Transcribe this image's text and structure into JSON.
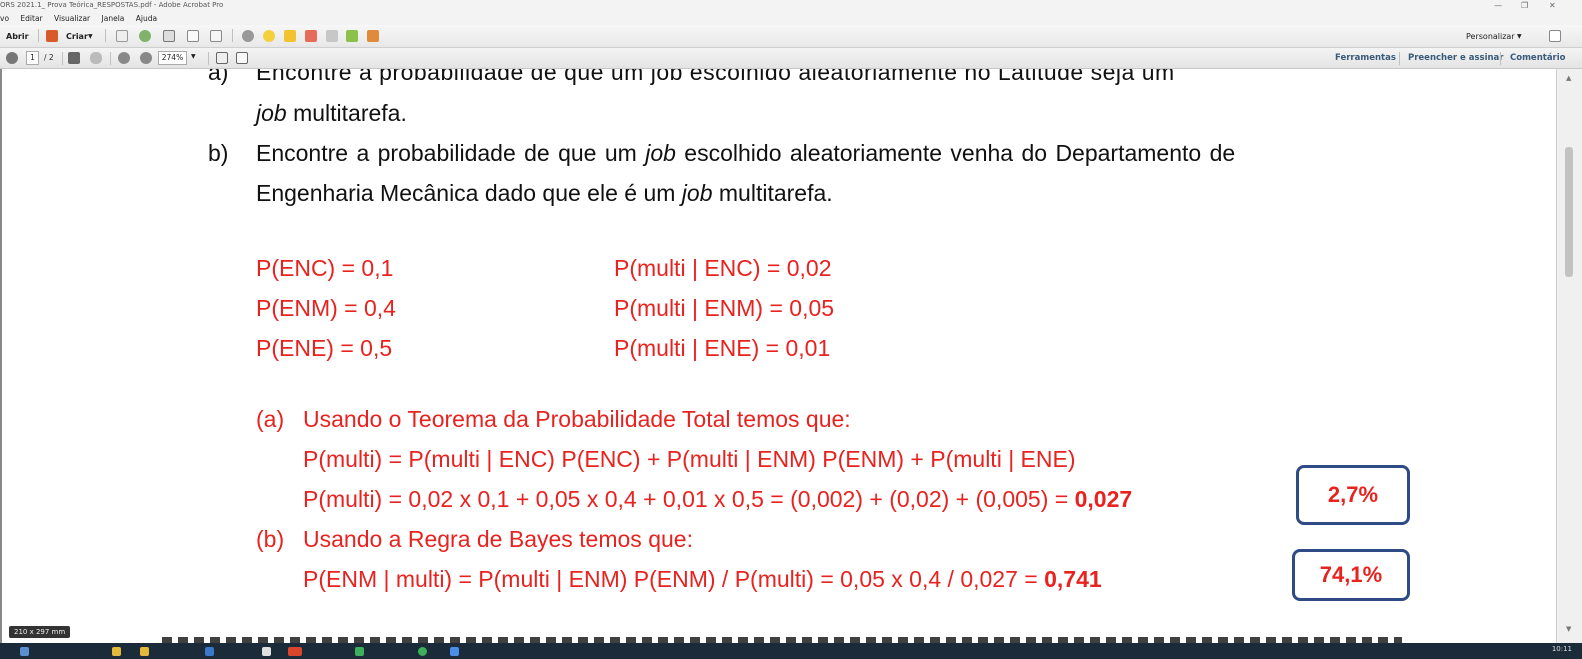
{
  "window": {
    "title": "ORS 2021.1_ Prova Teórica_RESPOSTAS.pdf - Adobe Acrobat Pro"
  },
  "menu": [
    "vo",
    "Editar",
    "Visualizar",
    "Janela",
    "Ajuda"
  ],
  "toolbar": {
    "open_label": "Abrir",
    "create_label": "Criar",
    "customize_label": "Personalizar"
  },
  "nav": {
    "page_current": "1",
    "page_total": "/ 2",
    "zoom": "274%",
    "tools_label": "Ferramentas",
    "fill_sign_label": "Preencher e assinar",
    "comment_label": "Comentário"
  },
  "document": {
    "item_a_label": "a)",
    "item_a_line1": "Encontre a probabilidade de que um job escolhido  aleatoriamente no Latitude seja um",
    "item_a_line2_italic": "job",
    "item_a_line2_rest": " multitarefa.",
    "item_b_label": "b)",
    "item_b_line1_pre": "Encontre a probabilidade de que um ",
    "item_b_line1_italic": "job",
    "item_b_line1_post": " escolhido  aleatoriamente venha do Departamento de",
    "item_b_line2_pre": "Engenharia Mecânica dado que ele é  um ",
    "item_b_line2_italic": "job",
    "item_b_line2_post": " multitarefa.",
    "given_left": [
      "P(ENC) = 0,1",
      "P(ENM) = 0,4",
      "P(ENE) = 0,5"
    ],
    "given_right": [
      "P(multi | ENC) = 0,02",
      "P(multi | ENM) = 0,05",
      "P(multi | ENE) = 0,01"
    ],
    "sol_a_label": "(a)",
    "sol_a_heading": "Usando o Teorema da Probabilidade Total temos que:",
    "sol_a_formula": "P(multi) = P(multi | ENC) P(ENC) + P(multi | ENM) P(ENM) + P(multi | ENE)",
    "sol_a_calc": "P(multi) = 0,02 x 0,1 + 0,05 x 0,4 + 0,01 x 0,5 = (0,002) + (0,02) + (0,005) = ",
    "sol_a_result": "0,027",
    "sol_a_box": "2,7%",
    "sol_b_label": "(b)",
    "sol_b_heading": "Usando a Regra de Bayes temos que:",
    "sol_b_calc": "P(ENM | multi) = P(multi | ENM) P(ENM) / P(multi) = 0,05 x 0,4 / 0,027 = ",
    "sol_b_result": "0,741",
    "sol_b_box": "74,1%"
  },
  "status": {
    "page_size": "210 x 297 mm",
    "clock": "10:11"
  },
  "colors": {
    "answer_red": "#e8231f",
    "box_blue": "#2e4b86"
  }
}
